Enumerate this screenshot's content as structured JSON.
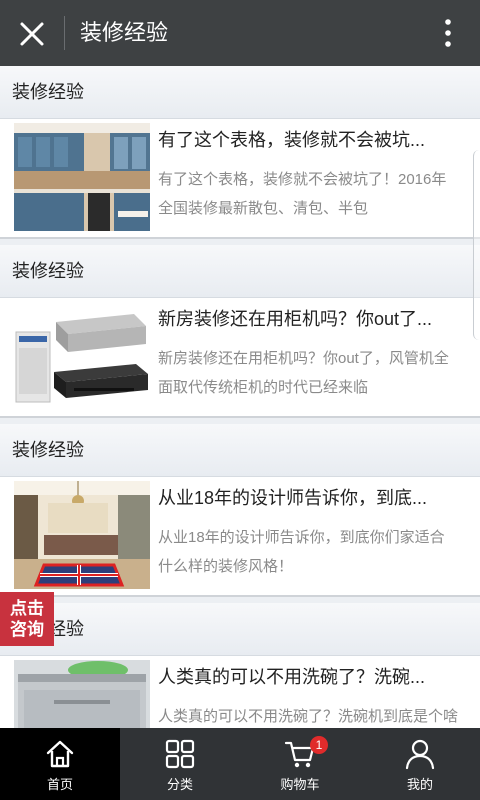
{
  "header": {
    "title": "装修经验"
  },
  "sections": [
    {
      "category": "装修经验",
      "title": "有了这个表格，装修就不会被坑...",
      "desc": "有了这个表格，装修就不会被坑了！2016年全国装修最新散包、清包、半包"
    },
    {
      "category": "装修经验",
      "title": "新房装修还在用柜机吗？你out了...",
      "desc": "新房装修还在用柜机吗？你out了，风管机全面取代传统柜机的时代已经来临"
    },
    {
      "category": "装修经验",
      "title": "从业18年的设计师告诉你，到底...",
      "desc": "从业18年的设计师告诉你，到底你们家适合什么样的装修风格！"
    },
    {
      "category": "装修经验",
      "title": "人类真的可以不用洗碗了？洗碗...",
      "desc": "人类真的可以不用洗碗了？洗碗机到底是个啥玩意儿"
    }
  ],
  "consult_button": {
    "label": "点击咨询"
  },
  "tabs": [
    {
      "label": "首页",
      "icon": "home-icon",
      "active": true
    },
    {
      "label": "分类",
      "icon": "grid-icon",
      "active": false
    },
    {
      "label": "购物车",
      "icon": "cart-icon",
      "active": false,
      "badge": "1"
    },
    {
      "label": "我的",
      "icon": "user-icon",
      "active": false
    }
  ],
  "colors": {
    "topbar": "#3e4143",
    "tabbar": "#303336",
    "accent_red": "#c8323e",
    "badge": "#e02b2b"
  }
}
